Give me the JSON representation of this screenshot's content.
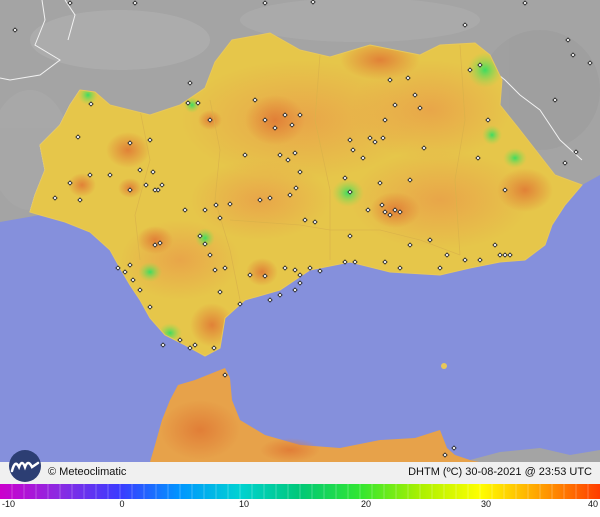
{
  "brand": {
    "name": "Meteoclimatic",
    "logo_icon": "meteoclimatic-logo-icon",
    "copyright_symbol": "©"
  },
  "map": {
    "region": "Andalucía",
    "variable": "DHTM (ºC)",
    "date": "30-08-2021",
    "time": "23:53 UTC",
    "info_line": "DHTM (ºC)  30-08-2021 @ 23:53 UTC",
    "credit_line": "© Meteoclimatic",
    "colors": {
      "sea": "#8590dc",
      "foreign_land": "#a9a9a9",
      "land_base": "#e8c845",
      "warm": "#e9a049",
      "hot": "#e58a3a",
      "cool": "#53d85a",
      "station_marker": "#1a1a1a"
    }
  },
  "scale": {
    "min": -10,
    "max": 40,
    "ticks": [
      "-10",
      "0",
      "10",
      "20",
      "30",
      "40"
    ],
    "gradient_stops": [
      "#cc00cc",
      "#8a2be2",
      "#3b3bff",
      "#0096ff",
      "#00d2d2",
      "#00c878",
      "#32e632",
      "#aaf000",
      "#ffff00",
      "#ffa000",
      "#ff3c00"
    ]
  }
}
